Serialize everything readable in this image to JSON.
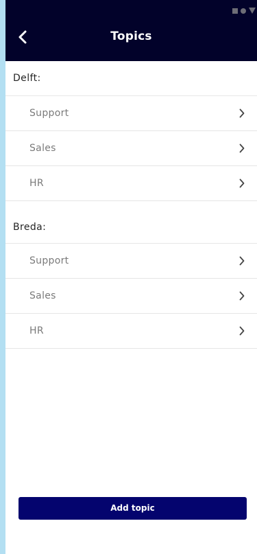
{
  "header": {
    "title": "Topics",
    "back_icon": "chevron-left-icon",
    "status_icons": [
      "square-icon",
      "circle-icon",
      "triangle-down-icon"
    ]
  },
  "sections": [
    {
      "title": "Delft:",
      "items": [
        {
          "label": "Support",
          "icon": "chevron-right-icon"
        },
        {
          "label": "Sales",
          "icon": "chevron-right-icon"
        },
        {
          "label": "HR",
          "icon": "chevron-right-icon"
        }
      ]
    },
    {
      "title": "Breda:",
      "items": [
        {
          "label": "Support",
          "icon": "chevron-right-icon"
        },
        {
          "label": "Sales",
          "icon": "chevron-right-icon"
        },
        {
          "label": "HR",
          "icon": "chevron-right-icon"
        }
      ]
    }
  ],
  "footer": {
    "add_label": "Add topic"
  },
  "colors": {
    "outer_background": "#b3dff2",
    "header_background": "#02022a",
    "button_background": "#04046e",
    "item_text": "#7a7a7a",
    "section_text": "#242424"
  }
}
